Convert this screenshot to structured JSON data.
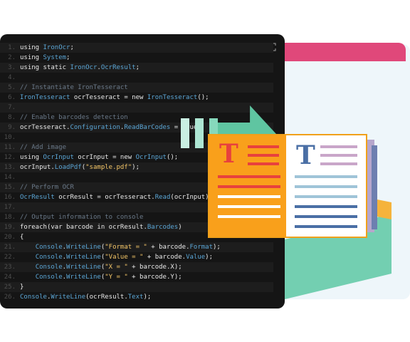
{
  "editor": {
    "icons": {
      "copy": "copy-icon",
      "expand": "expand-icon"
    },
    "lines": [
      {
        "n": "1.",
        "text": "using IronOcr;"
      },
      {
        "n": "2.",
        "text": "using System;"
      },
      {
        "n": "3.",
        "text": "using static IronOcr.OcrResult;"
      },
      {
        "n": "4.",
        "text": ""
      },
      {
        "n": "5.",
        "text": "// Instantiate IronTesseract"
      },
      {
        "n": "6.",
        "text": "IronTesseract ocrTesseract = new IronTesseract();"
      },
      {
        "n": "7.",
        "text": ""
      },
      {
        "n": "8.",
        "text": "// Enable barcodes detection"
      },
      {
        "n": "9.",
        "text": "ocrTesseract.Configuration.ReadBarCodes = true;"
      },
      {
        "n": "10.",
        "text": ""
      },
      {
        "n": "11.",
        "text": "// Add image"
      },
      {
        "n": "12.",
        "text": "using OcrInput ocrInput = new OcrInput();"
      },
      {
        "n": "13.",
        "text": "ocrInput.LoadPdf(\"sample.pdf\");"
      },
      {
        "n": "14.",
        "text": ""
      },
      {
        "n": "15.",
        "text": "// Perform OCR"
      },
      {
        "n": "16.",
        "text": "OcrResult ocrResult = ocrTesseract.Read(ocrInput);"
      },
      {
        "n": "17.",
        "text": ""
      },
      {
        "n": "18.",
        "text": "// Output information to console"
      },
      {
        "n": "19.",
        "text": "foreach(var barcode in ocrResult.Barcodes)"
      },
      {
        "n": "20.",
        "text": "{"
      },
      {
        "n": "21.",
        "text": "    Console.WriteLine(\"Format = \" + barcode.Format);"
      },
      {
        "n": "22.",
        "text": "    Console.WriteLine(\"Value = \" + barcode.Value);"
      },
      {
        "n": "23.",
        "text": "    Console.WriteLine(\"X = \" + barcode.X);"
      },
      {
        "n": "24.",
        "text": "    Console.WriteLine(\"Y = \" + barcode.Y);"
      },
      {
        "n": "25.",
        "text": "}"
      },
      {
        "n": "26.",
        "text": "Console.WriteLine(ocrResult.Text);"
      }
    ]
  },
  "illustration": {
    "left_page_letter": "T",
    "right_page_letter": "T",
    "colors": {
      "orange": "#f9a01b",
      "red": "#e8413d",
      "teal": "#5fc5a1",
      "pink": "#e0487a",
      "blue": "#4a6fa5",
      "purple": "#b6a6cc"
    }
  }
}
